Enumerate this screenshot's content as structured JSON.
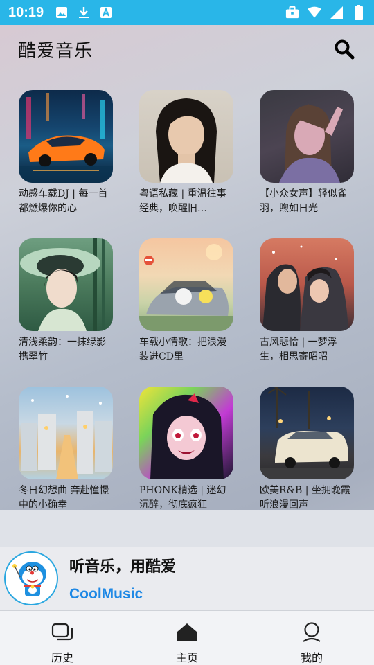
{
  "status_bar": {
    "time": "10:19",
    "left_icons": [
      "image-icon",
      "download-icon",
      "font-icon"
    ],
    "right_icons": [
      "briefcase-icon",
      "wifi-icon",
      "signal-icon",
      "battery-icon"
    ]
  },
  "header": {
    "title": "酷爱音乐",
    "search_icon": "search-icon"
  },
  "playlists": [
    {
      "title": "动感车载DJ | 每一首都燃爆你的心",
      "cover": "neon-sports-car"
    },
    {
      "title": "粤语私藏 | 重温往事经典，唤醒旧…",
      "cover": "portrait-woman-dark-hair"
    },
    {
      "title": "【小众女声】轻似雀羽，煦如日光",
      "cover": "portrait-woman-purple-light"
    },
    {
      "title": "清浅柔韵：一抹绿影携翠竹",
      "cover": "woman-green-hat-bamboo"
    },
    {
      "title": "车载小情歌：把浪漫装进CD里",
      "cover": "convertible-car-sunset"
    },
    {
      "title": "古风悲恰 | 一梦浮生，相思寄昭昭",
      "cover": "couple-in-snow"
    },
    {
      "title": "冬日幻想曲 奔赴憧憬中的小确幸",
      "cover": "winter-city-street"
    },
    {
      "title": "PHONK精选 | 迷幻沉醉，彻底疯狂",
      "cover": "anime-girl-psychedelic"
    },
    {
      "title": "欧美R&B | 坐拥晚霞听浪漫回声",
      "cover": "vintage-car-palm-trees"
    }
  ],
  "promo": {
    "slogan": "听音乐，用酷爱",
    "brand": "CoolMusic",
    "avatar": "doraemon-avatar"
  },
  "bottom_nav": [
    {
      "label": "历史",
      "icon": "history-icon"
    },
    {
      "label": "主页",
      "icon": "home-icon"
    },
    {
      "label": "我的",
      "icon": "profile-icon"
    }
  ],
  "colors": {
    "status_bar": "#29b6e8",
    "brand": "#1e88e5",
    "avatar_border": "#2aa7e0"
  }
}
